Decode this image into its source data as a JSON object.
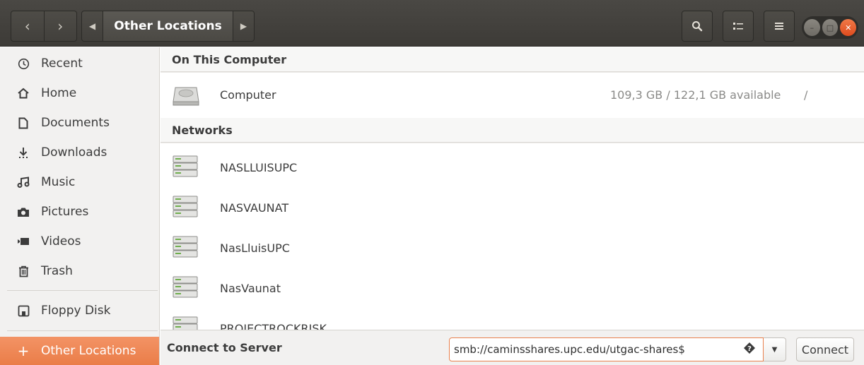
{
  "window": {
    "current_location": "Other Locations",
    "nav_back": "‹",
    "nav_forward": "›"
  },
  "sidebar": {
    "items": [
      {
        "label": "Recent",
        "icon": "clock-icon"
      },
      {
        "label": "Home",
        "icon": "home-icon"
      },
      {
        "label": "Documents",
        "icon": "document-icon"
      },
      {
        "label": "Downloads",
        "icon": "download-icon"
      },
      {
        "label": "Music",
        "icon": "music-icon"
      },
      {
        "label": "Pictures",
        "icon": "camera-icon"
      },
      {
        "label": "Videos",
        "icon": "video-icon"
      },
      {
        "label": "Trash",
        "icon": "trash-icon"
      }
    ],
    "devices": [
      {
        "label": "Floppy Disk",
        "icon": "floppy-icon"
      }
    ],
    "other_locations": {
      "label": "Other Locations",
      "icon": "plus-icon"
    }
  },
  "main": {
    "on_this_computer": {
      "header": "On This Computer",
      "items": [
        {
          "name": "Computer",
          "available": "109,3 GB / 122,1 GB available",
          "mount": "/",
          "icon": "hard-drive-icon"
        }
      ]
    },
    "networks": {
      "header": "Networks",
      "items": [
        {
          "name": "NASLLUISUPC",
          "icon": "network-server-icon"
        },
        {
          "name": "NASVAUNAT",
          "icon": "network-server-icon"
        },
        {
          "name": "NasLluisUPC",
          "icon": "network-server-icon"
        },
        {
          "name": "NasVaunat",
          "icon": "network-server-icon"
        },
        {
          "name": "PROJECTROCKRISK",
          "icon": "network-server-icon"
        }
      ]
    }
  },
  "bottom": {
    "connect_label": "Connect to Server",
    "server_address": "smb://caminsshares.upc.edu/utgac-shares$",
    "connect_button": "Connect"
  },
  "colors": {
    "accent": "#ea7d48",
    "headerbar": "#3d3b37",
    "sidebar_bg": "#f2f1f0"
  }
}
